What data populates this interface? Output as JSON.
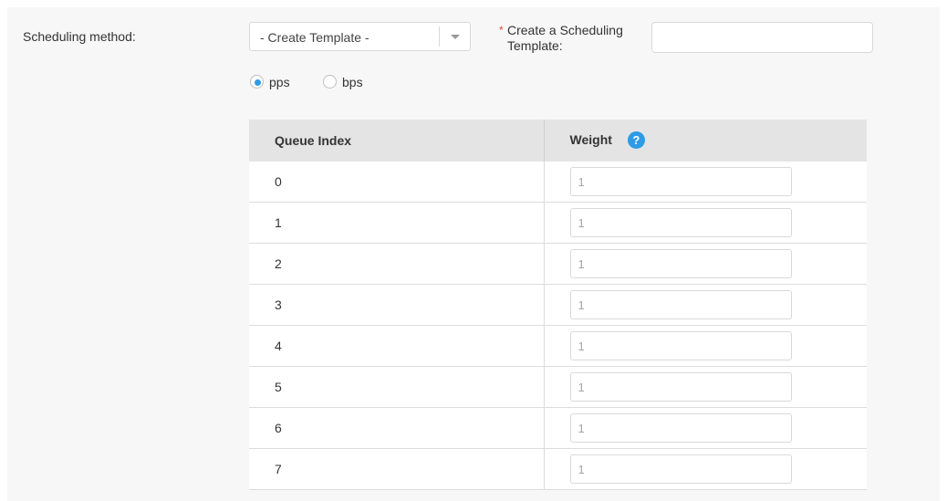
{
  "form": {
    "scheduling_method_label": "Scheduling method:",
    "scheduling_select_value": "- Create Template -",
    "required_marker": "*",
    "create_template_label": "Create a Scheduling Template:",
    "create_template_value": ""
  },
  "rate_unit": {
    "options": [
      {
        "label": "pps",
        "selected": true
      },
      {
        "label": "bps",
        "selected": false
      }
    ]
  },
  "table": {
    "headers": [
      "Queue Index",
      "Weight"
    ],
    "help_icon": "question-circle-icon",
    "rows": [
      {
        "index": "0",
        "weight": "1"
      },
      {
        "index": "1",
        "weight": "1"
      },
      {
        "index": "2",
        "weight": "1"
      },
      {
        "index": "3",
        "weight": "1"
      },
      {
        "index": "4",
        "weight": "1"
      },
      {
        "index": "5",
        "weight": "1"
      },
      {
        "index": "6",
        "weight": "1"
      },
      {
        "index": "7",
        "weight": "1"
      }
    ]
  },
  "colors": {
    "accent": "#2d9be6",
    "required": "#e24a3b",
    "header_bg": "#e4e4e4",
    "panel_bg": "#f7f7f7"
  }
}
